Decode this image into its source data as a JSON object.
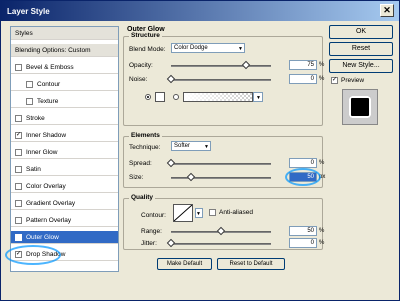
{
  "window": {
    "title": "Layer Style"
  },
  "sidebar": {
    "items": [
      {
        "label": "Styles",
        "type": "header"
      },
      {
        "label": "Blending Options: Custom",
        "type": "header"
      },
      {
        "label": "Bevel & Emboss",
        "checked": false
      },
      {
        "label": "Contour",
        "checked": false,
        "indent": true
      },
      {
        "label": "Texture",
        "checked": false,
        "indent": true
      },
      {
        "label": "Stroke",
        "checked": false
      },
      {
        "label": "Inner Shadow",
        "checked": true
      },
      {
        "label": "Inner Glow",
        "checked": false
      },
      {
        "label": "Satin",
        "checked": false
      },
      {
        "label": "Color Overlay",
        "checked": false
      },
      {
        "label": "Gradient Overlay",
        "checked": false
      },
      {
        "label": "Pattern Overlay",
        "checked": false
      },
      {
        "label": "Outer Glow",
        "checked": true,
        "selected": true
      },
      {
        "label": "Drop Shadow",
        "checked": true
      }
    ]
  },
  "outer_glow": {
    "title": "Outer Glow",
    "structure": {
      "label": "Structure",
      "blend_mode_label": "Blend Mode:",
      "blend_mode_value": "Color Dodge",
      "opacity_label": "Opacity:",
      "opacity_value": "75",
      "opacity_level": 0.75,
      "noise_label": "Noise:",
      "noise_value": "0",
      "noise_level": 0,
      "unit": "%"
    },
    "elements": {
      "label": "Elements",
      "technique_label": "Technique:",
      "technique_value": "Softer",
      "spread_label": "Spread:",
      "spread_value": "0",
      "spread_level": 0,
      "size_label": "Size:",
      "size_value": "50",
      "size_level": 0.2,
      "percent_unit": "%",
      "px_unit": "px"
    },
    "quality": {
      "label": "Quality",
      "contour_label": "Contour:",
      "anti_aliased_label": "Anti-aliased",
      "range_label": "Range:",
      "range_value": "50",
      "range_level": 0.5,
      "jitter_label": "Jitter:",
      "jitter_value": "0",
      "jitter_level": 0,
      "unit": "%"
    },
    "make_default_label": "Make Default",
    "reset_default_label": "Reset to Default"
  },
  "buttons": {
    "ok": "OK",
    "reset": "Reset",
    "new_style": "New Style...",
    "preview_label": "Preview",
    "preview_checked": true
  }
}
